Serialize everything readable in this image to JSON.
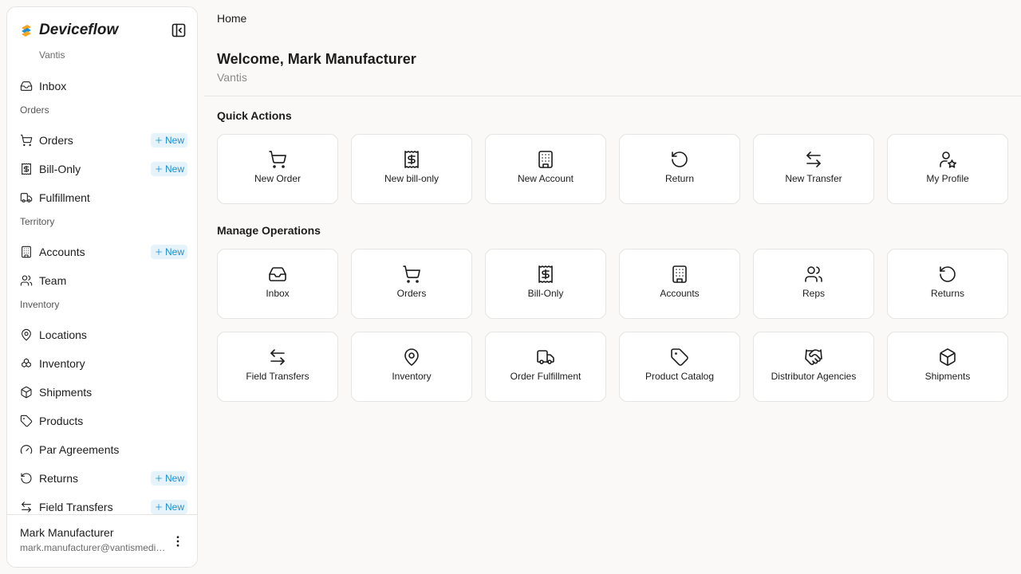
{
  "sidebar": {
    "brand": "Deviceflow",
    "org": "Vantis",
    "new_label": "New",
    "sections": {
      "orders": "Orders",
      "territory": "Territory",
      "inventory": "Inventory"
    },
    "items": {
      "inbox": "Inbox",
      "orders": "Orders",
      "bill_only": "Bill-Only",
      "fulfillment": "Fulfillment",
      "accounts": "Accounts",
      "team": "Team",
      "locations": "Locations",
      "inventory": "Inventory",
      "shipments": "Shipments",
      "products": "Products",
      "par_agreements": "Par Agreements",
      "returns": "Returns",
      "field_transfers": "Field Transfers"
    },
    "user": {
      "name": "Mark Manufacturer",
      "email": "mark.manufacturer@vantismedical.com"
    }
  },
  "main": {
    "breadcrumb": "Home",
    "welcome": "Welcome, Mark Manufacturer",
    "org": "Vantis",
    "quick_actions_title": "Quick Actions",
    "quick_actions": [
      "New Order",
      "New bill-only",
      "New Account",
      "Return",
      "New Transfer",
      "My Profile"
    ],
    "manage_title": "Manage Operations",
    "manage": [
      "Inbox",
      "Orders",
      "Bill-Only",
      "Accounts",
      "Reps",
      "Returns",
      "Field Transfers",
      "Inventory",
      "Order Fulfillment",
      "Product Catalog",
      "Distributor Agencies",
      "Shipments"
    ]
  },
  "colors": {
    "accent": "#1b8fd1",
    "badge_bg": "#e6f3fb",
    "background": "#faf9f7",
    "brand_orange": "#f5a623",
    "brand_blue": "#1b8fd1"
  }
}
